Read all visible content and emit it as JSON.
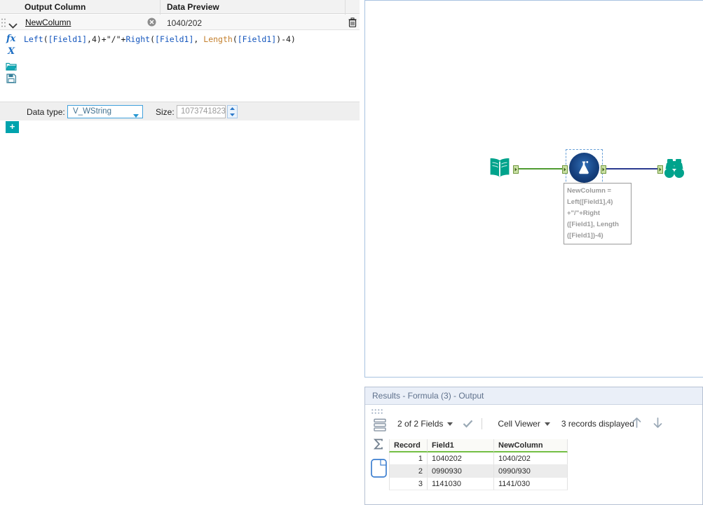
{
  "config": {
    "header": {
      "output_column": "Output Column",
      "data_preview": "Data Preview"
    },
    "row": {
      "name": "NewColumn",
      "preview": "1040/202"
    },
    "icons": {
      "fx": "fx",
      "x": "X"
    },
    "formula_tokens": [
      {
        "t": "Left",
        "c": "fn"
      },
      {
        "t": "(",
        "c": "p"
      },
      {
        "t": "[Field1]",
        "c": "fld"
      },
      {
        "t": ",4)+",
        "c": "p"
      },
      {
        "t": "\"/\"",
        "c": "str"
      },
      {
        "t": "+",
        "c": "p"
      },
      {
        "t": "Right",
        "c": "fn"
      },
      {
        "t": "(",
        "c": "p"
      },
      {
        "t": "[Field1]",
        "c": "fld"
      },
      {
        "t": ", ",
        "c": "p"
      },
      {
        "t": "Length",
        "c": "fn2"
      },
      {
        "t": "(",
        "c": "p"
      },
      {
        "t": "[Field1]",
        "c": "fld"
      },
      {
        "t": ")-4)",
        "c": "p"
      }
    ],
    "data_type": {
      "label": "Data type:",
      "value": "V_WString"
    },
    "size": {
      "label": "Size:",
      "value": "1073741823"
    },
    "add_button": "+"
  },
  "canvas": {
    "annotation": [
      "NewColumn =",
      "Left([Field1],4)",
      "+\"/\"+Right",
      "([Field1], Length",
      "([Field1])-4)"
    ]
  },
  "results": {
    "title": "Results - Formula (3) - Output",
    "toolbar": {
      "fields": "2 of 2 Fields",
      "cell_viewer": "Cell Viewer",
      "records": "3 records displayed"
    },
    "table": {
      "headers": [
        "Record",
        "Field1",
        "NewColumn"
      ],
      "rows": [
        [
          "1",
          "1040202",
          "1040/202"
        ],
        [
          "2",
          "0990930",
          "0990/930"
        ],
        [
          "3",
          "1141030",
          "1141/030"
        ]
      ]
    }
  },
  "colors": {
    "accent_teal": "#00a3ad",
    "tool_teal": "#00a38c",
    "formula_navy": "#16407e",
    "connection_green": "#4f9b31",
    "connection_navy": "#2b3a8f",
    "anchor_green": "#cbe3a6",
    "header_underline_green": "#74bf44",
    "dropdown_blue": "#41a1dc",
    "results_titlebar": "#eaeff8"
  }
}
